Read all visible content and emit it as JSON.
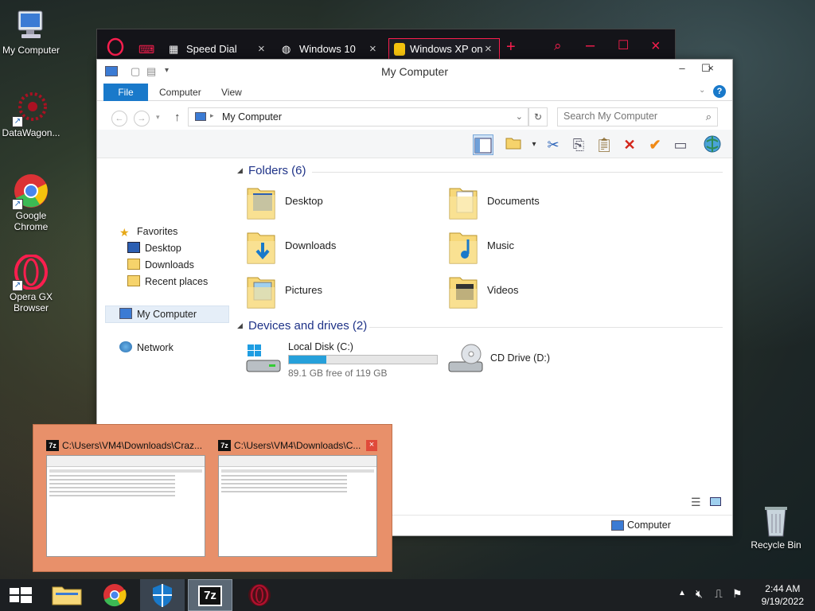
{
  "desktop": {
    "icons": [
      {
        "label": "My Computer"
      },
      {
        "label": "DataWagon..."
      },
      {
        "label": "Google Chrome"
      },
      {
        "label": "Opera GX Browser"
      },
      {
        "label": "Recycle Bin"
      }
    ]
  },
  "browser": {
    "tabs": [
      {
        "label": "Speed Dial"
      },
      {
        "label": "Windows 10"
      },
      {
        "label": "Windows XP on"
      }
    ],
    "accent": "#fa1e4e"
  },
  "explorer": {
    "title": "My Computer",
    "ribbon_tabs": [
      "File",
      "Computer",
      "View"
    ],
    "address": "My Computer",
    "search_placeholder": "Search My Computer",
    "nav": {
      "favorites": "Favorites",
      "desktop": "Desktop",
      "downloads": "Downloads",
      "recent": "Recent places",
      "mycomputer": "My Computer",
      "network": "Network"
    },
    "folders_header": "Folders (6)",
    "folders": [
      "Desktop",
      "Documents",
      "Downloads",
      "Music",
      "Pictures",
      "Videos"
    ],
    "drives_header": "Devices and drives (2)",
    "drives": [
      {
        "name": "Local Disk (C:)",
        "free": "89.1 GB free of 119 GB",
        "used_fraction": 0.25
      },
      {
        "name": "CD Drive (D:)"
      }
    ],
    "status_location": "Computer"
  },
  "thumbnails": [
    {
      "title": "C:\\Users\\VM4\\Downloads\\Craz..."
    },
    {
      "title": "C:\\Users\\VM4\\Downloads\\C..."
    }
  ],
  "taskbar": {
    "time": "2:44 AM",
    "date": "9/19/2022"
  }
}
